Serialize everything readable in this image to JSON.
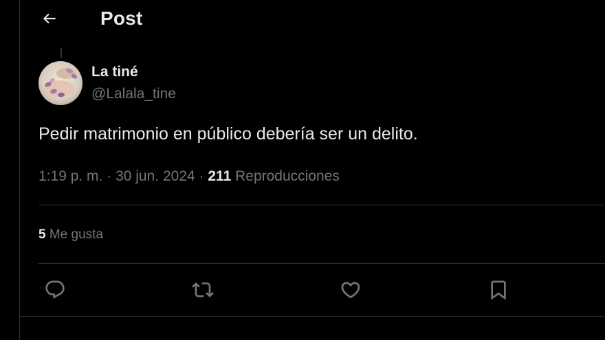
{
  "header": {
    "title": "Post",
    "back_icon": "arrow-left-icon"
  },
  "post": {
    "author": {
      "display_name": "La tiné",
      "handle": "@Lalala_tine"
    },
    "text": "Pedir matrimonio en público debería ser un delito.",
    "time": "1:19 p. m.",
    "separator": "·",
    "date": "30 jun. 2024",
    "views_count": "211",
    "views_label": "Reproducciones",
    "likes_count": "5",
    "likes_label": "Me gusta"
  },
  "actions": [
    {
      "name": "reply",
      "icon": "reply-icon"
    },
    {
      "name": "repost",
      "icon": "repost-icon"
    },
    {
      "name": "like",
      "icon": "heart-icon"
    },
    {
      "name": "bookmark",
      "icon": "bookmark-icon"
    }
  ],
  "colors": {
    "background": "#000000",
    "primary_text": "#e7e9ea",
    "secondary_text": "#71767b",
    "border": "#2f3336"
  }
}
